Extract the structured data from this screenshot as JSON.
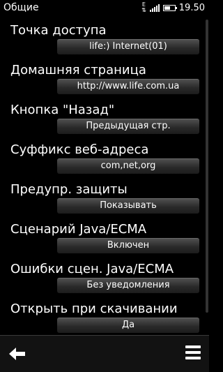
{
  "status": {
    "title": "Общие",
    "network_top": "E",
    "network_bottom": "⇅",
    "time": "19.50",
    "battery_level": 0.55,
    "signal_bars": 4
  },
  "settings": [
    {
      "label": "Точка доступа",
      "value": "life:) Internet(01)"
    },
    {
      "label": "Домашняя страница",
      "value": "http://www.life.com.ua"
    },
    {
      "label": "Кнопка \"Назад\"",
      "value": "Предыдущая стр."
    },
    {
      "label": "Суффикс веб-адреса",
      "value": "com,net,org"
    },
    {
      "label": "Предупр. защиты",
      "value": "Показывать"
    },
    {
      "label": "Сценарий Java/ECMA",
      "value": "Включен"
    },
    {
      "label": "Ошибки сцен. Java/ECMA",
      "value": "Без уведомления"
    },
    {
      "label": "Открыть при скачивании",
      "value": "Да"
    }
  ],
  "toolbar": {
    "back_icon": "back-arrow-icon",
    "menu_icon": "menu-icon"
  }
}
